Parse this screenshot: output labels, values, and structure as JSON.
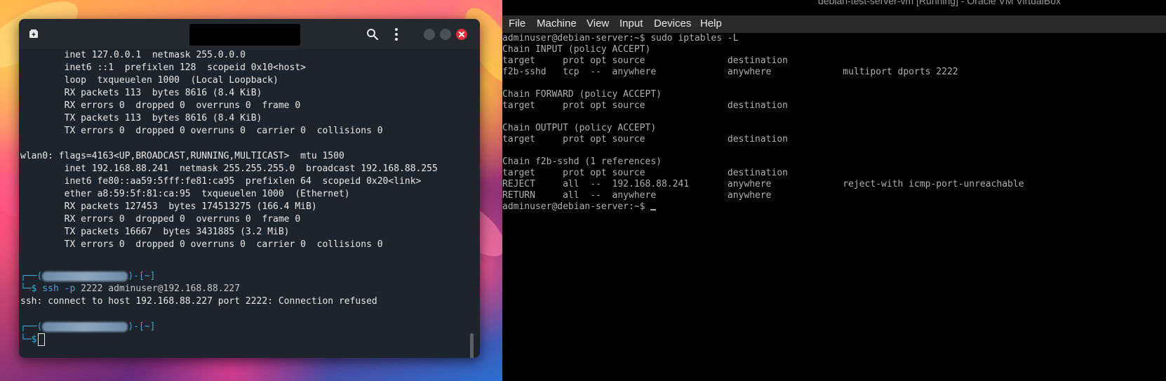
{
  "vbox": {
    "window_title": "debian-test-server-vm [Running] - Oracle VM VirtualBox",
    "menu": [
      "File",
      "Machine",
      "View",
      "Input",
      "Devices",
      "Help"
    ],
    "console_lines": [
      "adminuser@debian-server:~$ sudo iptables -L",
      "Chain INPUT (policy ACCEPT)",
      "target     prot opt source               destination",
      "f2b-sshd   tcp  --  anywhere             anywhere             multiport dports 2222",
      "",
      "Chain FORWARD (policy ACCEPT)",
      "target     prot opt source               destination",
      "",
      "Chain OUTPUT (policy ACCEPT)",
      "target     prot opt source               destination",
      "",
      "Chain f2b-sshd (1 references)",
      "target     prot opt source               destination",
      "REJECT     all  --  192.168.88.241       anywhere             reject-with icmp-port-unreachable",
      "RETURN     all  --  anywhere             anywhere"
    ],
    "final_prompt": "adminuser@debian-server:~$ "
  },
  "terminal": {
    "output_lines": [
      "        inet 127.0.0.1  netmask 255.0.0.0",
      "        inet6 ::1  prefixlen 128  scopeid 0x10<host>",
      "        loop  txqueuelen 1000  (Local Loopback)",
      "        RX packets 113  bytes 8616 (8.4 KiB)",
      "        RX errors 0  dropped 0  overruns 0  frame 0",
      "        TX packets 113  bytes 8616 (8.4 KiB)",
      "        TX errors 0  dropped 0 overruns 0  carrier 0  collisions 0",
      "",
      "wlan0: flags=4163<UP,BROADCAST,RUNNING,MULTICAST>  mtu 1500",
      "        inet 192.168.88.241  netmask 255.255.255.0  broadcast 192.168.88.255",
      "        inet6 fe80::aa59:5fff:fe81:ca95  prefixlen 64  scopeid 0x20<link>",
      "        ether a8:59:5f:81:ca:95  txqueuelen 1000  (Ethernet)",
      "        RX packets 127453  bytes 174513275 (166.4 MiB)",
      "        RX errors 0  dropped 0  overruns 0  frame 0",
      "        TX packets 16667  bytes 3431885 (3.2 MiB)",
      "        TX errors 0  dropped 0 overruns 0  carrier 0  collisions 0"
    ],
    "prompt_top_start": "┌──(",
    "prompt_top_end": ")-[~]",
    "prompt_bottom": "└─$",
    "ssh_cmd": "ssh",
    "ssh_flag": "-p",
    "ssh_args": "2222 adminuser@192.168.88.227",
    "ssh_error": "ssh: connect to host 192.168.88.227 port 2222: Connection refused"
  },
  "colors": {
    "prompt_accent": "#3fa7d6",
    "close_button": "#e0303a",
    "terminal_bg": "#1e242b",
    "vm_console_bg": "#000000"
  },
  "icons": {
    "new_tab": "new-tab-icon",
    "search": "search-icon",
    "menu": "kebab-menu-icon",
    "minimize": "minimize-icon",
    "maximize": "maximize-icon",
    "close": "close-icon"
  }
}
